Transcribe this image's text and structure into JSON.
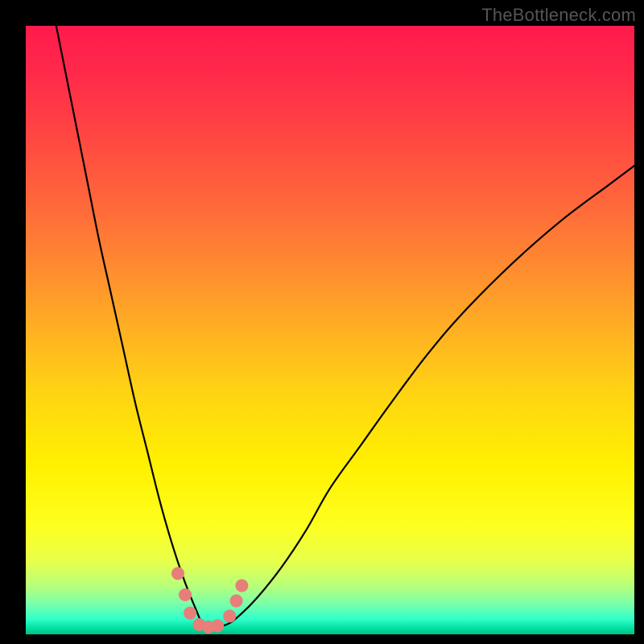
{
  "watermark": "TheBottleneck.com",
  "chart_data": {
    "type": "line",
    "title": "",
    "xlabel": "",
    "ylabel": "",
    "xlim": [
      0,
      100
    ],
    "ylim": [
      0,
      100
    ],
    "grid": false,
    "legend": false,
    "background_gradient": {
      "top": "#ff1a4d",
      "bottom": "#00c088"
    },
    "series": [
      {
        "name": "bottleneck-curve",
        "color": "#000000",
        "x": [
          4,
          6,
          8,
          10,
          12,
          14,
          16,
          18,
          20,
          22,
          24,
          26,
          28,
          29,
          30,
          31,
          33,
          35,
          38,
          42,
          46,
          50,
          55,
          60,
          66,
          72,
          80,
          88,
          96,
          100
        ],
        "values": [
          105,
          95,
          85,
          75,
          65,
          56,
          47,
          38,
          30,
          22,
          15,
          9,
          4,
          1.8,
          1.2,
          1.2,
          1.6,
          3,
          6,
          11,
          17,
          24,
          31,
          38,
          46,
          53,
          61,
          68,
          74,
          77
        ]
      }
    ],
    "markers": [
      {
        "x": 25.0,
        "y": 10.0
      },
      {
        "x": 26.2,
        "y": 6.5
      },
      {
        "x": 27.0,
        "y": 3.5
      },
      {
        "x": 28.5,
        "y": 1.6
      },
      {
        "x": 30.0,
        "y": 1.2
      },
      {
        "x": 31.5,
        "y": 1.4
      },
      {
        "x": 33.5,
        "y": 3.0
      },
      {
        "x": 34.6,
        "y": 5.5
      },
      {
        "x": 35.5,
        "y": 8.0
      }
    ],
    "marker_style": {
      "color": "#e77e7a",
      "radius_px": 8
    }
  }
}
